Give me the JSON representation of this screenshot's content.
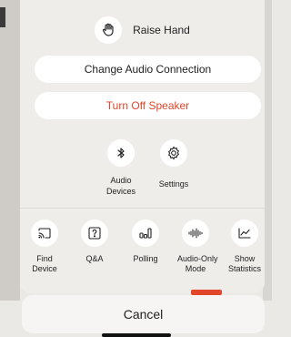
{
  "raise_hand": {
    "label": "Raise Hand",
    "icon": "hand-icon"
  },
  "audio_connection_button": {
    "label": "Change Audio Connection"
  },
  "speaker_button": {
    "label": "Turn Off Speaker",
    "color": "#e2462b"
  },
  "middle_actions": [
    {
      "label_line1": "Audio",
      "label_line2": "Devices",
      "icon": "bluetooth-icon"
    },
    {
      "label_line1": "Settings",
      "label_line2": "",
      "icon": "gear-icon"
    }
  ],
  "bottom_actions": [
    {
      "label_line1": "Find",
      "label_line2": "Device",
      "icon": "cast-icon"
    },
    {
      "label_line1": "Q&A",
      "label_line2": "",
      "icon": "question-icon"
    },
    {
      "label_line1": "Polling",
      "label_line2": "",
      "icon": "poll-icon"
    },
    {
      "label_line1": "Audio-Only",
      "label_line2": "Mode",
      "icon": "audio-wave-icon"
    },
    {
      "label_line1": "Show",
      "label_line2": "Statistics",
      "icon": "chart-icon"
    }
  ],
  "cancel": {
    "label": "Cancel"
  }
}
